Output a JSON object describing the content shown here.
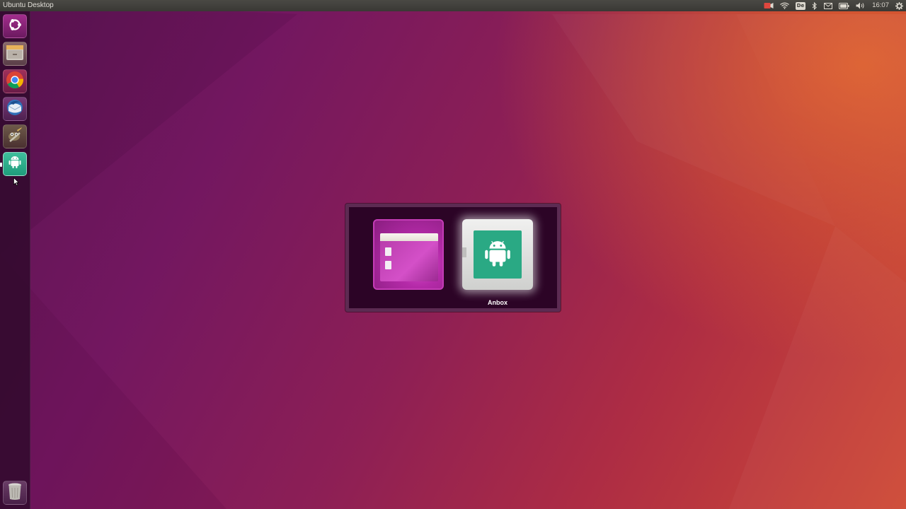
{
  "top_panel": {
    "title": "Ubuntu Desktop",
    "clock": "16:07",
    "keyboard_layout": "De",
    "indicators": [
      "video-record-icon",
      "wifi-icon",
      "keyboard-layout-icon",
      "bluetooth-icon",
      "mail-icon",
      "battery-icon",
      "volume-icon",
      "gear-icon"
    ]
  },
  "launcher": {
    "items": [
      {
        "name": "dash-home",
        "icon": "ubuntu-logo-icon"
      },
      {
        "name": "files",
        "icon": "file-cabinet-icon"
      },
      {
        "name": "chrome",
        "icon": "chrome-icon"
      },
      {
        "name": "thunderbird",
        "icon": "thunderbird-icon"
      },
      {
        "name": "gimp",
        "icon": "gimp-icon"
      },
      {
        "name": "anbox",
        "icon": "android-icon",
        "active": true
      },
      {
        "name": "trash",
        "icon": "trash-icon"
      }
    ]
  },
  "switcher": {
    "items": [
      {
        "name": "files-window",
        "icon": "files-window-icon"
      },
      {
        "name": "anbox",
        "icon": "android-icon",
        "selected": true
      }
    ],
    "selected_label": "Anbox"
  },
  "colors": {
    "accent": "#2aa984",
    "panel": "#3c3b37",
    "launcher": "#320a2d"
  }
}
